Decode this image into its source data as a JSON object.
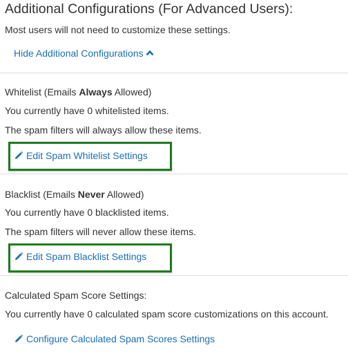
{
  "header": {
    "title": "Additional Configurations (For Advanced Users):",
    "subtitle": "Most users will not need to customize these settings.",
    "hide_link": "Hide Additional Configurations"
  },
  "whitelist": {
    "title_prefix": "Whitelist (Emails ",
    "title_bold": "Always",
    "title_suffix": " Allowed)",
    "count_text": "You currently have 0 whitelisted items.",
    "info_text": "The spam filters will always allow these items.",
    "edit_link": "Edit Spam Whitelist Settings"
  },
  "blacklist": {
    "title_prefix": "Blacklist (Emails ",
    "title_bold": "Never",
    "title_suffix": " Allowed)",
    "count_text": "You currently have 0 blacklisted items.",
    "info_text": "The spam filters will never allow these items.",
    "edit_link": "Edit Spam Blacklist Settings"
  },
  "score": {
    "title": "Calculated Spam Score Settings:",
    "count_text": "You currently have 0 calculated spam score customizations on this account.",
    "configure_link": "Configure Calculated Spam Scores Settings"
  },
  "colors": {
    "link": "#1a6fb4",
    "highlight_border": "#1e7b1e",
    "separator": "#dddddd"
  },
  "icons": {
    "collapse": "chevron-up-icon",
    "edit": "pencil-icon"
  }
}
